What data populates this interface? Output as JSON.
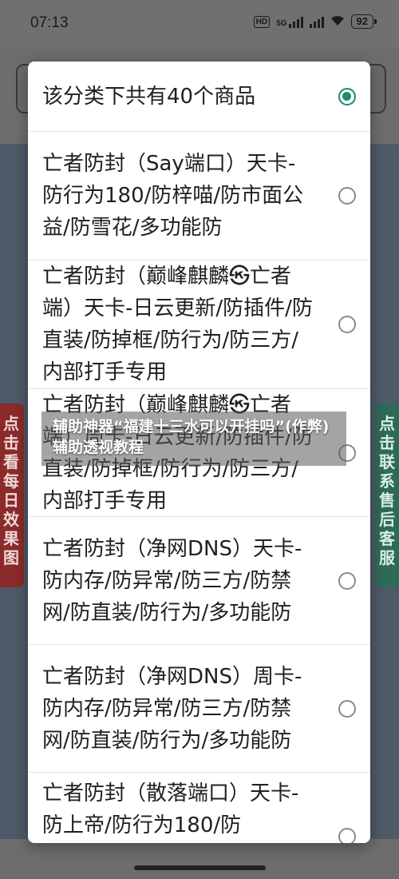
{
  "status_bar": {
    "time": "07:13",
    "hd_label": "HD",
    "network_label": "5G",
    "battery": "92"
  },
  "background": {
    "left_panel_text": "点击看每日效果图",
    "right_panel_text": "点击联系售后客服"
  },
  "dialog": {
    "options": [
      {
        "label": "该分类下共有40个商品",
        "selected": true
      },
      {
        "label": "亡者防封（Say端口）天卡-防行为180/防梓喵/防市面公益/防雪花/多功能防",
        "selected": false
      },
      {
        "label": "亡者防封（巅峰麒麟㉿亡者端）天卡-日云更新/防插件/防直装/防掉框/防行为/防三方/内部打手专用",
        "selected": false
      },
      {
        "label": "亡者防封（巅峰麒麟㉿亡者端）周卡-日云更新/防插件/防直装/防掉框/防行为/防三方/内部打手专用",
        "selected": false
      },
      {
        "label": "亡者防封（净网DNS）天卡-防内存/防异常/防三方/防禁网/防直装/防行为/多功能防",
        "selected": false
      },
      {
        "label": "亡者防封（净网DNS）周卡-防内存/防异常/防三方/防禁网/防直装/防行为/多功能防",
        "selected": false
      },
      {
        "label": "亡者防封（散落端口）天卡-防上帝/防行为180/防",
        "selected": false
      }
    ]
  },
  "caption": "辅助神器“福建十三水可以开挂吗”(作弊)辅助透视教程",
  "colors": {
    "accent": "#1b8a70",
    "dim_overlay": "#6f6f6f"
  }
}
